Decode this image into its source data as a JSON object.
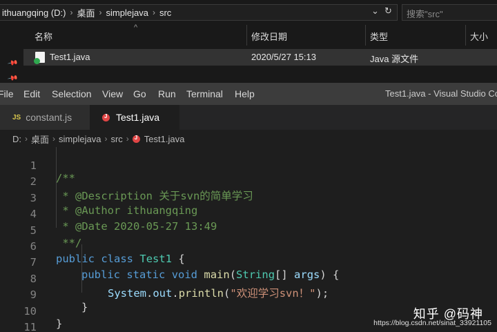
{
  "explorer": {
    "path": [
      "ithuangqing (D:)",
      "桌面",
      "simplejava",
      "src"
    ],
    "search_placeholder": "搜索\"src\"",
    "columns": [
      "名称",
      "修改日期",
      "类型",
      "大小"
    ],
    "files": [
      {
        "name": "Test1.java",
        "modified": "2020/5/27 15:13",
        "type": "Java 源文件"
      }
    ]
  },
  "menubar": {
    "items": [
      "File",
      "Edit",
      "Selection",
      "View",
      "Go",
      "Run",
      "Terminal",
      "Help"
    ],
    "window_title": "Test1.java - Visual Studio Code"
  },
  "tabs": [
    {
      "label": "constant.js",
      "icon": "js-file-icon",
      "active": false
    },
    {
      "label": "Test1.java",
      "icon": "java-file-icon",
      "active": true
    }
  ],
  "breadcrumbs": [
    "D:",
    "桌面",
    "simplejava",
    "src",
    "Test1.java"
  ],
  "editor": {
    "line_numbers": [
      "1",
      "2",
      "3",
      "4",
      "5",
      "6",
      "7",
      "8",
      "9",
      "10",
      "11"
    ],
    "lines": {
      "l1": "/**",
      "l2_prefix": " * ",
      "l2_tag": "@Description",
      "l2_text": " 关于svn的简单学习",
      "l3_prefix": " * ",
      "l3_tag": "@Author",
      "l3_text": " ithuangqing",
      "l4_prefix": " * ",
      "l4_tag": "@Date",
      "l4_text": " 2020-05-27 13:49",
      "l5": " **/",
      "l6_kw1": "public",
      "l6_kw2": "class",
      "l6_name": "Test1",
      "l6_brace": " {",
      "l7_kw1": "public",
      "l7_kw2": "static",
      "l7_kw3": "void",
      "l7_fn": "main",
      "l7_p1": "(",
      "l7_type": "String",
      "l7_p2": "[] ",
      "l7_arg": "args",
      "l7_p3": ") {",
      "l8_obj": "System",
      "l8_dot1": ".",
      "l8_field": "out",
      "l8_dot2": ".",
      "l8_fn": "println",
      "l8_p1": "(",
      "l8_str": "\"欢迎学习svn！\"",
      "l8_p2": ");",
      "l9": "}",
      "l10": "}"
    }
  },
  "watermark": {
    "brand": "知乎 @码神",
    "url": "https://blog.csdn.net/sinat_33921105"
  },
  "colors": {
    "comment": "#6a9955",
    "keyword": "#569cd6",
    "type": "#4ec9b0",
    "function": "#dcdcaa",
    "variable": "#9cdcfe",
    "string": "#ce9178"
  }
}
